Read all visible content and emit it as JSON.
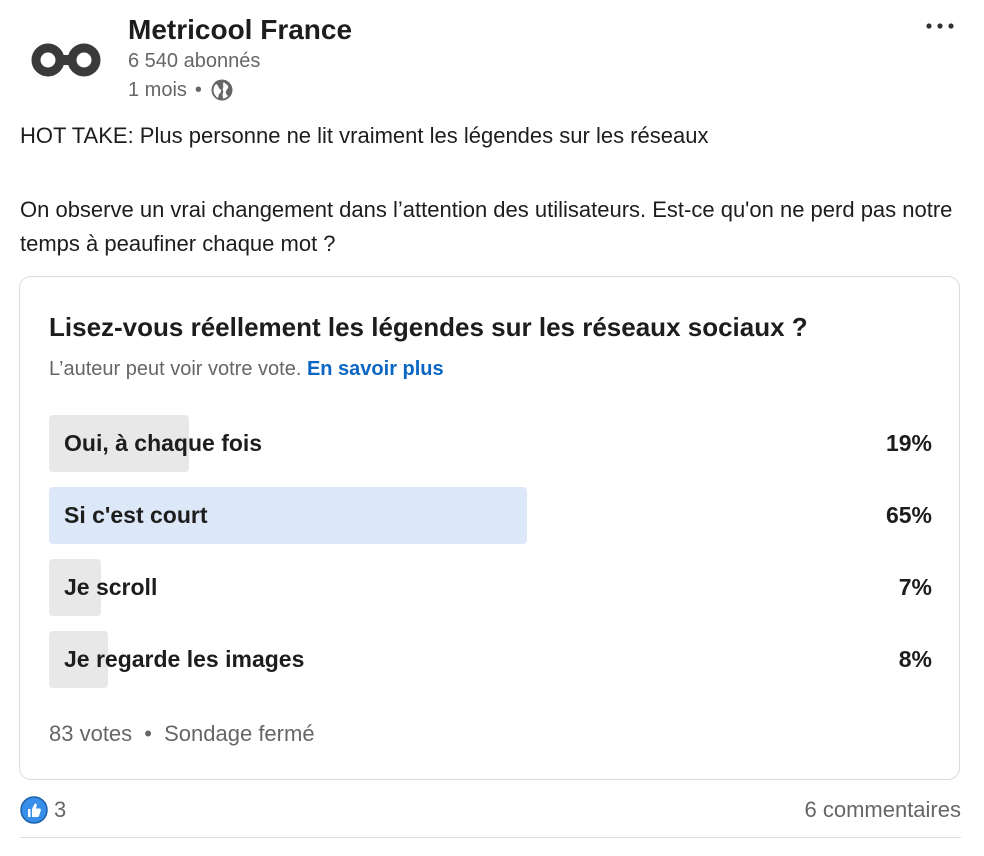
{
  "post": {
    "author": "Metricool France",
    "followers": "6 540 abonnés",
    "age": "1 mois",
    "dot": "•",
    "text_line1": "HOT TAKE:  Plus personne ne lit vraiment les légendes sur les réseaux",
    "text_line2": "On observe un vrai changement dans l’attention des utilisateurs. Est-ce qu'on ne perd pas notre temps à peaufiner chaque mot ?"
  },
  "poll": {
    "question": "Lisez-vous réellement les légendes sur les réseaux sociaux ?",
    "note": "L’auteur peut voir votre vote.",
    "learn_more": "En savoir plus",
    "options": [
      {
        "label": "Oui, à chaque fois",
        "percent": "19%",
        "value": 19,
        "selected": false
      },
      {
        "label": "Si c'est court",
        "percent": "65%",
        "value": 65,
        "selected": true
      },
      {
        "label": "Je scroll",
        "percent": "7%",
        "value": 7,
        "selected": false
      },
      {
        "label": "Je regarde les images",
        "percent": "8%",
        "value": 8,
        "selected": false
      }
    ],
    "votes": "83 votes",
    "separator": "•",
    "status": "Sondage fermé"
  },
  "engagement": {
    "likes": "3",
    "comments": "6 commentaires"
  },
  "icons": {
    "logo": "metricool-logo",
    "globe": "globe-icon",
    "more": "more-options-icon",
    "like": "like-icon"
  },
  "colors": {
    "link": "#0a66c2",
    "bar_default": "#e8e8e8",
    "bar_selected": "#dce7f7"
  }
}
